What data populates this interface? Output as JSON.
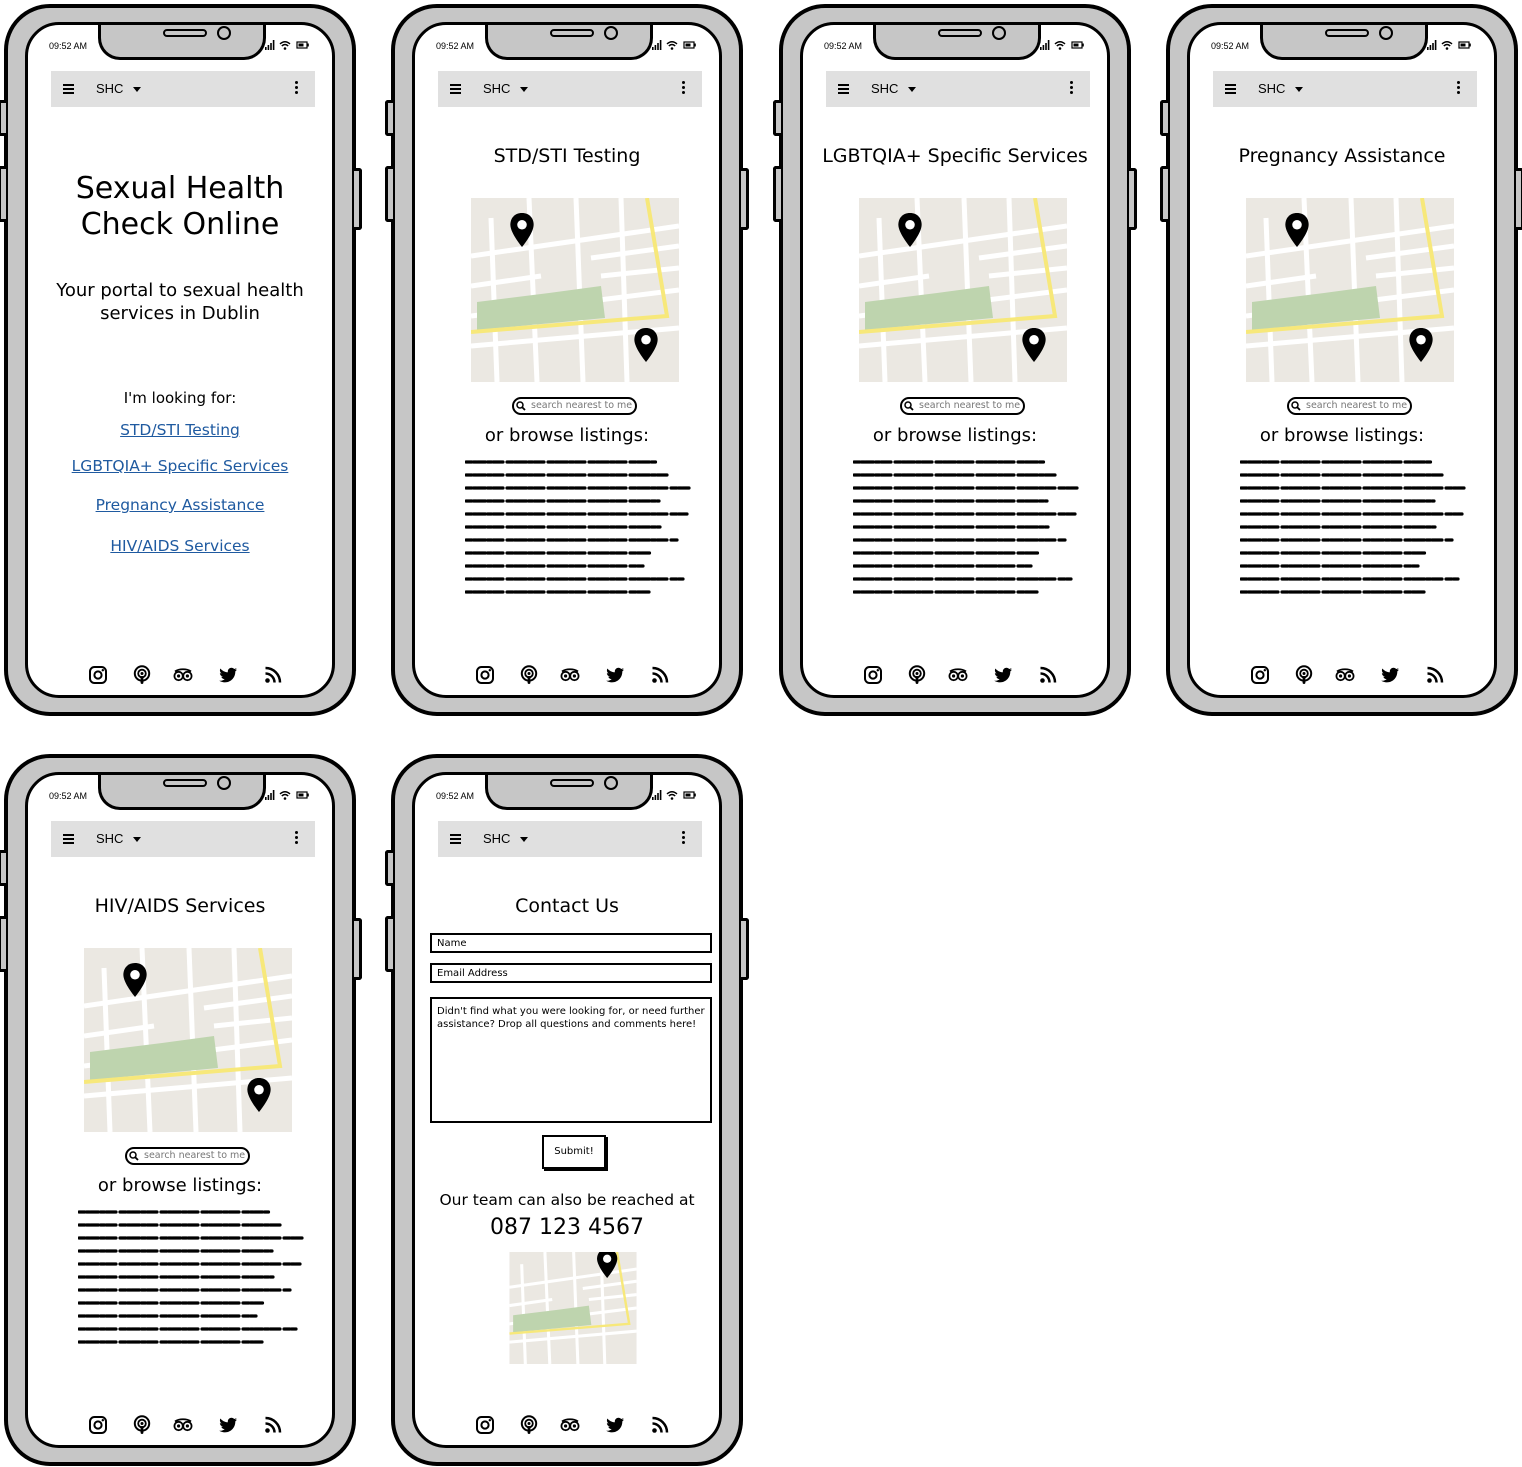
{
  "status": {
    "time": "09:52 AM"
  },
  "appbar": {
    "title": "SHC"
  },
  "home": {
    "title_line1": "Sexual Health",
    "title_line2": "Check Online",
    "subtitle": "Your portal to sexual health services in Dublin",
    "looking_for": "I'm looking for:",
    "links": [
      "STD/STI Testing",
      "LGBTQIA+ Specific Services",
      "Pregnancy Assistance",
      "HIV/AIDS Services"
    ]
  },
  "service_pages": [
    {
      "title": "STD/STI Testing"
    },
    {
      "title": "LGBTQIA+ Specific Services"
    },
    {
      "title": "Pregnancy Assistance"
    },
    {
      "title": "HIV/AIDS Services"
    }
  ],
  "search": {
    "placeholder": "search nearest to me"
  },
  "browse_label": "or browse listings:",
  "contact": {
    "title": "Contact Us",
    "name_placeholder": "Name",
    "email_placeholder": "Email Address",
    "message_placeholder": "Didn't find what you were looking for, or need further assistance? Drop all questions and comments here!",
    "submit_label": "Submit!",
    "reach_text": "Our team can also be reached at",
    "phone": "087 123 4567"
  },
  "footer_icons": [
    "instagram-icon",
    "podcast-icon",
    "tripadvisor-icon",
    "twitter-icon",
    "rss-icon"
  ],
  "colors": {
    "appbar": "#e0e0e0",
    "link": "#1f5aa0",
    "frame": "#c6c6c6",
    "map_road_yellow": "#f7e87a",
    "map_park": "#bed4ae",
    "map_bg": "#ebe8e2"
  }
}
